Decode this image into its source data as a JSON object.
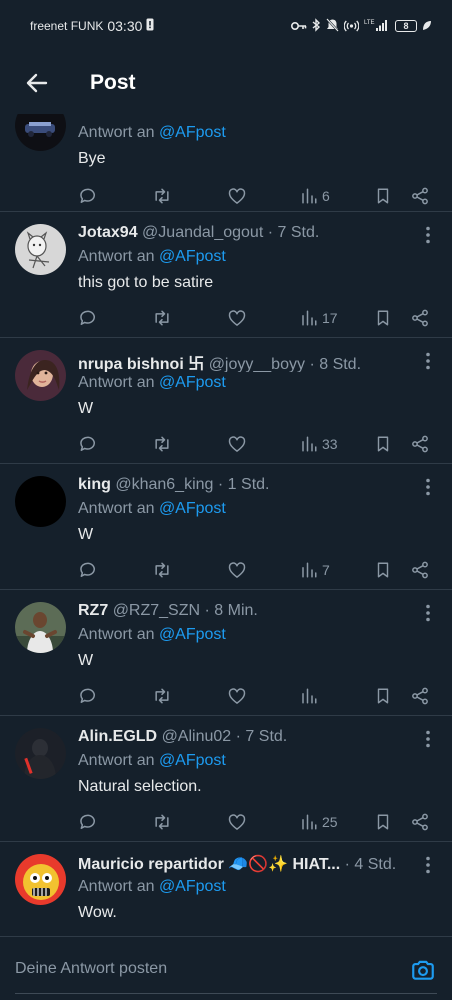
{
  "status_bar": {
    "carrier": "freenet FUNK",
    "time": "03:30",
    "network": "LTE",
    "battery": "8"
  },
  "header": {
    "title": "Post"
  },
  "tweets": [
    {
      "name": "",
      "handle": "",
      "time": "",
      "reply_prefix": "Antwort an ",
      "reply_to": "@AFpost",
      "text": "Bye",
      "views": "6"
    },
    {
      "name": "Jotax94",
      "handle": "@Juandal_ogout",
      "dot": "·",
      "time": "7 Std.",
      "reply_prefix": "Antwort an ",
      "reply_to": "@AFpost",
      "text": "this got to be satire",
      "views": "17"
    },
    {
      "name": "nrupa bishnoi 卐",
      "handle": "@joyy__boyy",
      "dot": "·",
      "time": "8 Std.",
      "reply_prefix": "Antwort an ",
      "reply_to": "@AFpost",
      "text": "W",
      "views": "33"
    },
    {
      "name": "king",
      "handle": "@khan6_king",
      "dot": "·",
      "time": "1 Std.",
      "reply_prefix": "Antwort an ",
      "reply_to": "@AFpost",
      "text": "W",
      "views": "7"
    },
    {
      "name": "RZ7",
      "handle": "@RZ7_SZN",
      "dot": "·",
      "time": "8 Min.",
      "reply_prefix": "Antwort an ",
      "reply_to": "@AFpost",
      "text": "W",
      "views": ""
    },
    {
      "name": "Alin.EGLD",
      "handle": "@Alinu02",
      "dot": "·",
      "time": "7 Std.",
      "reply_prefix": "Antwort an ",
      "reply_to": "@AFpost",
      "text": "Natural selection.",
      "views": "25"
    },
    {
      "name": "Mauricio repartidor 🧢🚫✨ HIAT...",
      "handle": "",
      "dot": "·",
      "time": "4 Std.",
      "reply_prefix": "Antwort an ",
      "reply_to": "@AFpost",
      "text": "Wow.",
      "views": ""
    }
  ],
  "reply_bar": {
    "placeholder": "Deine Antwort posten"
  }
}
